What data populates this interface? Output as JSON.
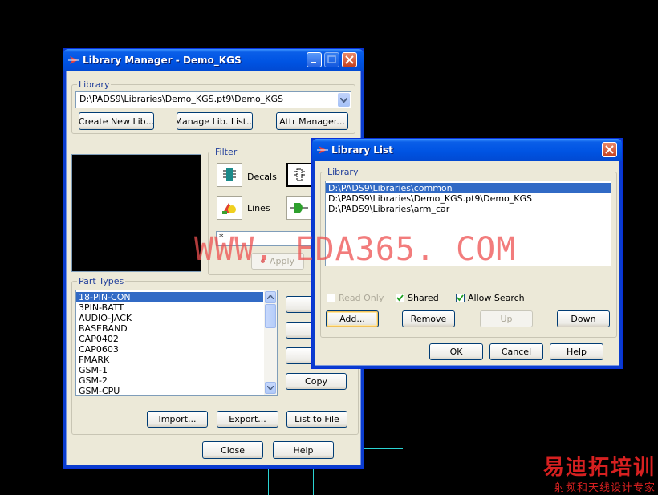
{
  "library_manager": {
    "title": "Library Manager - Demo_KGS",
    "library_group_label": "Library",
    "library_path": "D:\\PADS9\\Libraries\\Demo_KGS.pt9\\Demo_KGS",
    "create_new_lib": "Create New Lib...",
    "manage_lib_list": "Manage Lib. List...",
    "attr_manager": "Attr Manager...",
    "filter_label": "Filter",
    "decals_label": "Decals",
    "lines_label": "Lines",
    "filter_text": "*",
    "apply": "Apply",
    "part_types_label": "Part Types",
    "part_types": [
      "18-PIN-CON",
      "3PIN-BATT",
      "AUDIO-JACK",
      "BASEBAND",
      "CAP0402",
      "CAP0603",
      "FMARK",
      "GSM-1",
      "GSM-2",
      "GSM-CPU"
    ],
    "side_buttons": [
      "Ne",
      "E",
      "De",
      "Copy"
    ],
    "import": "Import...",
    "export": "Export...",
    "list_to_file": "List to File",
    "close": "Close",
    "help": "Help"
  },
  "library_list": {
    "title": "Library List",
    "library_group_label": "Library",
    "items": [
      "D:\\PADS9\\Libraries\\common",
      "D:\\PADS9\\Libraries\\Demo_KGS.pt9\\Demo_KGS",
      "D:\\PADS9\\Libraries\\arm_car"
    ],
    "read_only": "Read Only",
    "shared": "Shared",
    "allow_search": "Allow Search",
    "add": "Add...",
    "remove": "Remove",
    "up": "Up",
    "down": "Down",
    "ok": "OK",
    "cancel": "Cancel",
    "help": "Help"
  },
  "overlay": {
    "watermark": "WWW. EDA365. COM",
    "brand": "易迪拓培训",
    "brand_sub": "射频和天线设计专家"
  },
  "colors": {
    "title_blue": "#0054e3",
    "selection": "#316ac5",
    "dialog_bg": "#ece9d8",
    "watermark": "#ee5050"
  }
}
